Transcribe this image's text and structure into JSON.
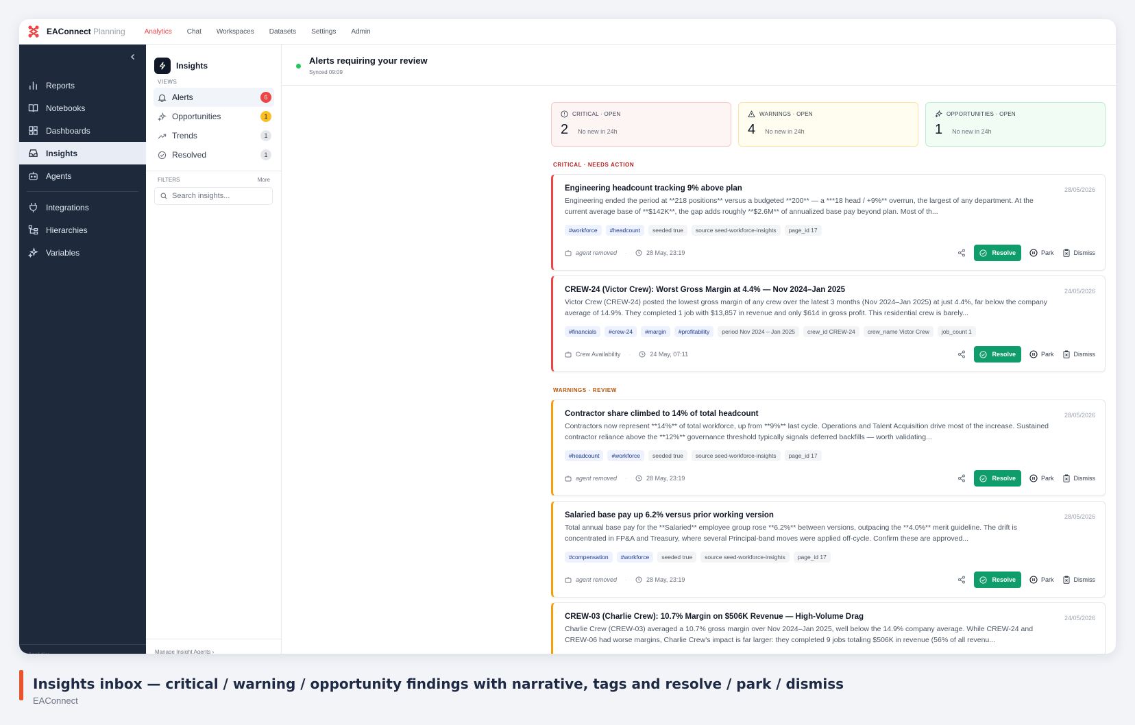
{
  "app": {
    "name": "EAConnect",
    "name_sub": "Planning"
  },
  "topnav": [
    {
      "label": "Analytics",
      "active": true
    },
    {
      "label": "Chat"
    },
    {
      "label": "Workspaces"
    },
    {
      "label": "Datasets"
    },
    {
      "label": "Settings"
    },
    {
      "label": "Admin"
    }
  ],
  "sidebar": {
    "items": [
      {
        "label": "Reports",
        "icon": "bar-chart-icon"
      },
      {
        "label": "Notebooks",
        "icon": "book-icon"
      },
      {
        "label": "Dashboards",
        "icon": "grid-icon"
      },
      {
        "label": "Insights",
        "icon": "inbox-icon",
        "active": true
      },
      {
        "label": "Agents",
        "icon": "bot-icon"
      },
      {
        "label": "Integrations",
        "icon": "plug-icon"
      },
      {
        "label": "Hierarchies",
        "icon": "hierarchy-icon"
      },
      {
        "label": "Variables",
        "icon": "sparkle-icon"
      }
    ],
    "footer": "Analytics"
  },
  "views": {
    "title": "Insights",
    "section_views": "VIEWS",
    "items": [
      {
        "label": "Alerts",
        "count": "6",
        "color": "#ef4444"
      },
      {
        "label": "Opportunities",
        "count": "1",
        "color": "#fbbf24"
      },
      {
        "label": "Trends",
        "count": "1"
      },
      {
        "label": "Resolved",
        "count": "1"
      }
    ],
    "section_filters": "FILTERS",
    "more": "More",
    "search_placeholder": "Search insights...",
    "footer": "Manage Insight Agents  ›"
  },
  "main": {
    "title": "Alerts requiring your review",
    "synced": "Synced 09:09"
  },
  "stats": [
    {
      "label": "CRITICAL · OPEN",
      "value": "2",
      "sub": "No new in 24h"
    },
    {
      "label": "WARNINGS · OPEN",
      "value": "4",
      "sub": "No new in 24h"
    },
    {
      "label": "OPPORTUNITIES · OPEN",
      "value": "1",
      "sub": "No new in 24h"
    }
  ],
  "groups": {
    "critical": "CRITICAL · NEEDS ACTION",
    "warnings": "WARNINGS · REVIEW"
  },
  "actions": {
    "resolve": "Resolve",
    "park": "Park",
    "dismiss": "Dismiss"
  },
  "cards": [
    {
      "title": "Engineering headcount tracking 9% above plan",
      "date": "28/05/2026",
      "body": "Engineering ended the period at **218 positions** versus a budgeted **200** — a ***18 head / +9%** overrun, the largest of any department. At the current average base of **$142K**, the gap adds roughly **$2.6M** of annualized base pay beyond plan. Most of th...",
      "tags": [
        "#workforce",
        "#headcount"
      ],
      "meta_tags": [
        "seeded true",
        "source seed-workforce-insights",
        "page_id 17"
      ],
      "source": "agent removed",
      "time": "28 May, 23:19"
    },
    {
      "title": "CREW-24 (Victor Crew): Worst Gross Margin at 4.4% — Nov 2024–Jan 2025",
      "date": "24/05/2026",
      "body": "Victor Crew (CREW-24) posted the lowest gross margin of any crew over the latest 3 months (Nov 2024–Jan 2025) at just 4.4%, far below the company average of 14.9%. They completed 1 job with $13,857 in revenue and only $614 in gross profit. This residential crew is barely...",
      "tags": [
        "#financials",
        "#crew-24",
        "#margin",
        "#profitability"
      ],
      "meta_tags": [
        "period Nov 2024 – Jan 2025",
        "crew_id CREW-24",
        "crew_name Victor Crew",
        "job_count 1"
      ],
      "source": "Crew Availability",
      "time": "24 May, 07:11"
    },
    {
      "title": "Contractor share climbed to 14% of total headcount",
      "date": "28/05/2026",
      "body": "Contractors now represent **14%** of total workforce, up from **9%** last cycle. Operations and Talent Acquisition drive most of the increase. Sustained contractor reliance above the **12%** governance threshold typically signals deferred backfills — worth validating...",
      "tags": [
        "#headcount",
        "#workforce"
      ],
      "meta_tags": [
        "seeded true",
        "source seed-workforce-insights",
        "page_id 17"
      ],
      "source": "agent removed",
      "time": "28 May, 23:19"
    },
    {
      "title": "Salaried base pay up 6.2% versus prior working version",
      "date": "28/05/2026",
      "body": "Total annual base pay for the **Salaried** employee group rose **6.2%** between versions, outpacing the **4.0%** merit guideline. The drift is concentrated in FP&A and Treasury, where several Principal-band moves were applied off-cycle. Confirm these are approved...",
      "tags": [
        "#compensation",
        "#workforce"
      ],
      "meta_tags": [
        "seeded true",
        "source seed-workforce-insights",
        "page_id 17"
      ],
      "source": "agent removed",
      "time": "28 May, 23:19"
    },
    {
      "title": "CREW-03 (Charlie Crew): 10.7% Margin on $506K Revenue — High-Volume Drag",
      "date": "24/05/2026",
      "body": "Charlie Crew (CREW-03) averaged a 10.7% gross margin over Nov 2024–Jan 2025, well below the 14.9% company average. While CREW-24 and CREW-06 had worse margins, Charlie Crew's impact is far larger: they completed 9 jobs totaling $506K in revenue (56% of all revenu...",
      "tags": [],
      "meta_tags": [],
      "source": "",
      "time": ""
    }
  ],
  "caption": {
    "title": "Insights inbox — critical / warning / opportunity findings with narrative, tags and resolve / park / dismiss",
    "sub": "EAConnect"
  }
}
